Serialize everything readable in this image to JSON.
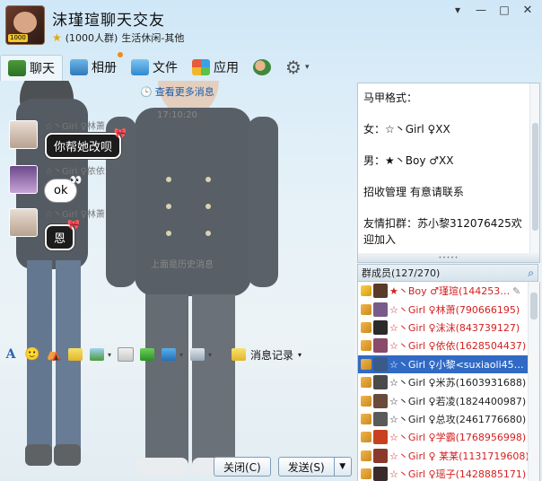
{
  "window": {
    "group_name": "沫瑾瑄聊天交友",
    "member_capacity": "(1000人群)",
    "category": "生活休闲-其他",
    "avatar_tag": "1000"
  },
  "tabs": [
    {
      "label": "聊天"
    },
    {
      "label": "相册"
    },
    {
      "label": "文件"
    },
    {
      "label": "应用"
    }
  ],
  "chat": {
    "more_messages": "查看更多消息",
    "timestamp": "17:10:20",
    "messages": [
      {
        "sender": "☆丶Girl ♀林萧",
        "text": "你帮她改呗"
      },
      {
        "sender": "☆丶Girl ♀依依",
        "text": "ok"
      },
      {
        "sender": "☆丶Girl ♀林萧",
        "text": "恩"
      }
    ],
    "history_label": "上面是历史消息"
  },
  "toolbar": {
    "record_label": "消息记录"
  },
  "buttons": {
    "close": "关闭(C)",
    "send": "发送(S)"
  },
  "announcement": {
    "text": "马甲格式：\n\n女：☆丶Girl ♀XX\n\n男：★丶Boy ♂XX\n\n招收管理 有意请联系\n\n友情扣群：苏小黎312076425欢迎加入"
  },
  "members": {
    "title": "群成员(127/270)",
    "list": [
      {
        "name": "★丶Boy ♂瑾瑄(144253…",
        "style": "owner"
      },
      {
        "name": "☆丶Girl ♀林萧(790666195)",
        "style": "red"
      },
      {
        "name": "☆丶Girl ♀沫沫(843739127)",
        "style": "red"
      },
      {
        "name": "☆丶Girl ♀依依(1628504437)",
        "style": "red"
      },
      {
        "name": "☆丶Girl ♀小黎<suxiaoli45…",
        "style": "selected"
      },
      {
        "name": "☆丶Girl ♀米苏(1603931688)",
        "style": "normal"
      },
      {
        "name": "☆丶Girl ♀若凌(1824400987)",
        "style": "normal"
      },
      {
        "name": "☆丶Girl ♀总攻(2461776680)",
        "style": "normal"
      },
      {
        "name": "☆丶Girl ♀学霸(1768956998)",
        "style": "red"
      },
      {
        "name": "☆丶Girl ♀ 某某(1131719608)",
        "style": "red"
      },
      {
        "name": "☆丶Girl ♀瑶子(1428885171)",
        "style": "red"
      }
    ]
  },
  "colors": {
    "accent": "#316ac5",
    "name_red": "#d42020",
    "link_blue": "#1a5ca8"
  }
}
